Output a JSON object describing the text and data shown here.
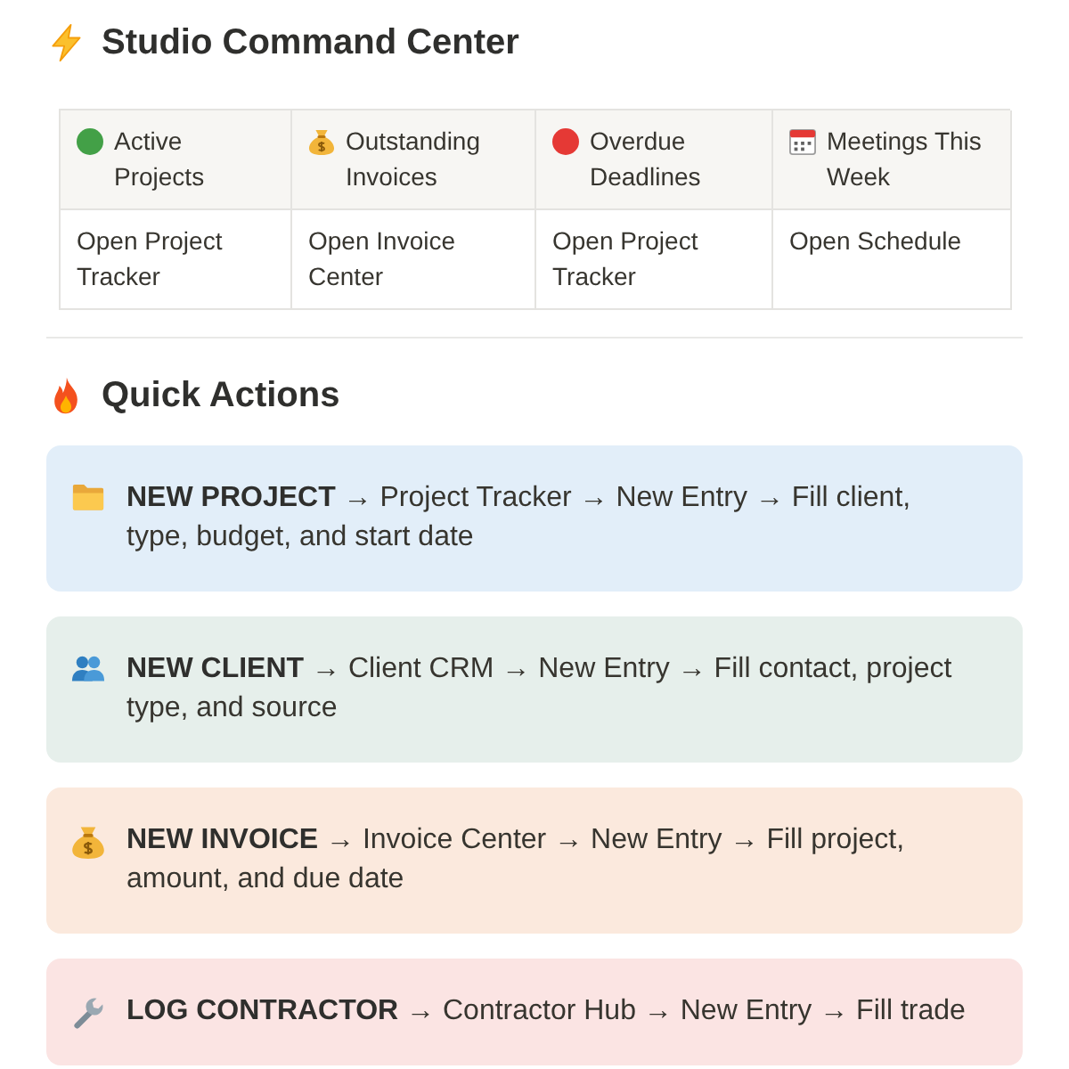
{
  "header": {
    "title": "Studio Command Center"
  },
  "summary_table": {
    "columns": [
      {
        "kind": "dot",
        "color": "#43a047",
        "label": "Active Projects"
      },
      {
        "kind": "money-bag",
        "label": "Outstanding Invoices"
      },
      {
        "kind": "dot",
        "color": "#e53935",
        "label": "Overdue Deadlines"
      },
      {
        "kind": "calendar",
        "label": "Meetings This Week"
      }
    ],
    "rows": [
      [
        "Open Project Tracker",
        "Open Invoice Center",
        "Open Project Tracker",
        "Open Schedule"
      ]
    ]
  },
  "quick_actions": {
    "title": "Quick Actions",
    "items": [
      {
        "kind": "folder",
        "color": "#e2eef9",
        "text": "**NEW PROJECT** → Project Tracker → New Entry → Fill client, type, budget, and start date"
      },
      {
        "kind": "people",
        "color": "#e6efeb",
        "text": "**NEW CLIENT** → Client CRM → New Entry → Fill contact, project type, and source"
      },
      {
        "kind": "money-bag",
        "color": "#fbe9dd",
        "text": "**NEW INVOICE** → Invoice Center → New Entry → Fill project, amount, and due date"
      },
      {
        "kind": "wrench",
        "color": "#fbe4e3",
        "text": "**LOG CONTRACTOR** → Contractor Hub → New Entry → Fill trade"
      }
    ]
  }
}
